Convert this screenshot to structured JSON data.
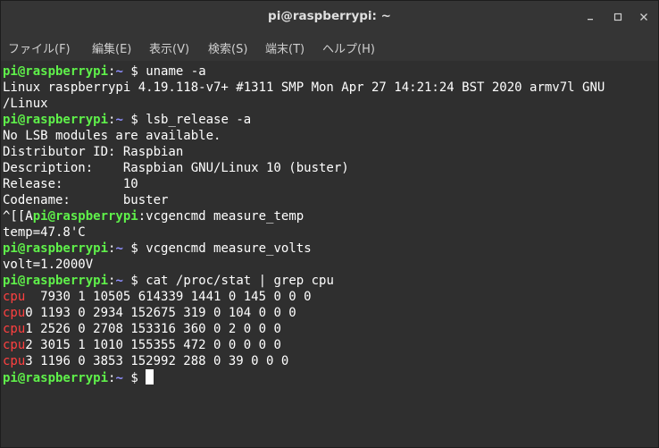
{
  "window": {
    "title": "pi@raspberrypi: ~"
  },
  "menu": [
    {
      "label": "ファイル(F)"
    },
    {
      "label": "編集(E)"
    },
    {
      "label": "表示(V)"
    },
    {
      "label": "検索(S)"
    },
    {
      "label": "端末(T)"
    },
    {
      "label": "ヘルプ(H)"
    }
  ],
  "prompt": {
    "user": "pi@raspberrypi",
    "sep": ":",
    "path": "~",
    "dollar": " $ "
  },
  "colors": {
    "user": "#5ff14a",
    "path": "#8f8fff",
    "cpu": "#ff4040",
    "bg": "#2f2f2f"
  },
  "lines": [
    {
      "type": "prompt",
      "cmd": "uname -a"
    },
    {
      "type": "out",
      "text": "Linux raspberrypi 4.19.118-v7+ #1311 SMP Mon Apr 27 14:21:24 BST 2020 armv7l GNU"
    },
    {
      "type": "out",
      "text": "/Linux"
    },
    {
      "type": "prompt",
      "cmd": "lsb_release -a"
    },
    {
      "type": "out",
      "text": "No LSB modules are available."
    },
    {
      "type": "out",
      "text": "Distributor ID:\tRaspbian"
    },
    {
      "type": "out",
      "text": "Description:\tRaspbian GNU/Linux 10 (buster)"
    },
    {
      "type": "out",
      "text": "Release:\t10"
    },
    {
      "type": "out",
      "text": "Codename:\tbuster"
    },
    {
      "type": "escprompt",
      "prefix": "^[[A",
      "cmd": "vcgencmd measure_temp"
    },
    {
      "type": "out",
      "text": "temp=47.8'C"
    },
    {
      "type": "prompt",
      "cmd": "vcgencmd measure_volts"
    },
    {
      "type": "out",
      "text": "volt=1.2000V"
    },
    {
      "type": "prompt",
      "cmd": "cat /proc/stat | grep cpu"
    },
    {
      "type": "cpu",
      "key": "cpu",
      "rest": "  7930 1 10505 614339 1441 0 145 0 0 0"
    },
    {
      "type": "cpu",
      "key": "cpu",
      "rest": "0 1193 0 2934 152675 319 0 104 0 0 0"
    },
    {
      "type": "cpu",
      "key": "cpu",
      "rest": "1 2526 0 2708 153316 360 0 2 0 0 0"
    },
    {
      "type": "cpu",
      "key": "cpu",
      "rest": "2 3015 1 1010 155355 472 0 0 0 0 0"
    },
    {
      "type": "cpu",
      "key": "cpu",
      "rest": "3 1196 0 3853 152992 288 0 39 0 0 0"
    },
    {
      "type": "cursor"
    }
  ]
}
